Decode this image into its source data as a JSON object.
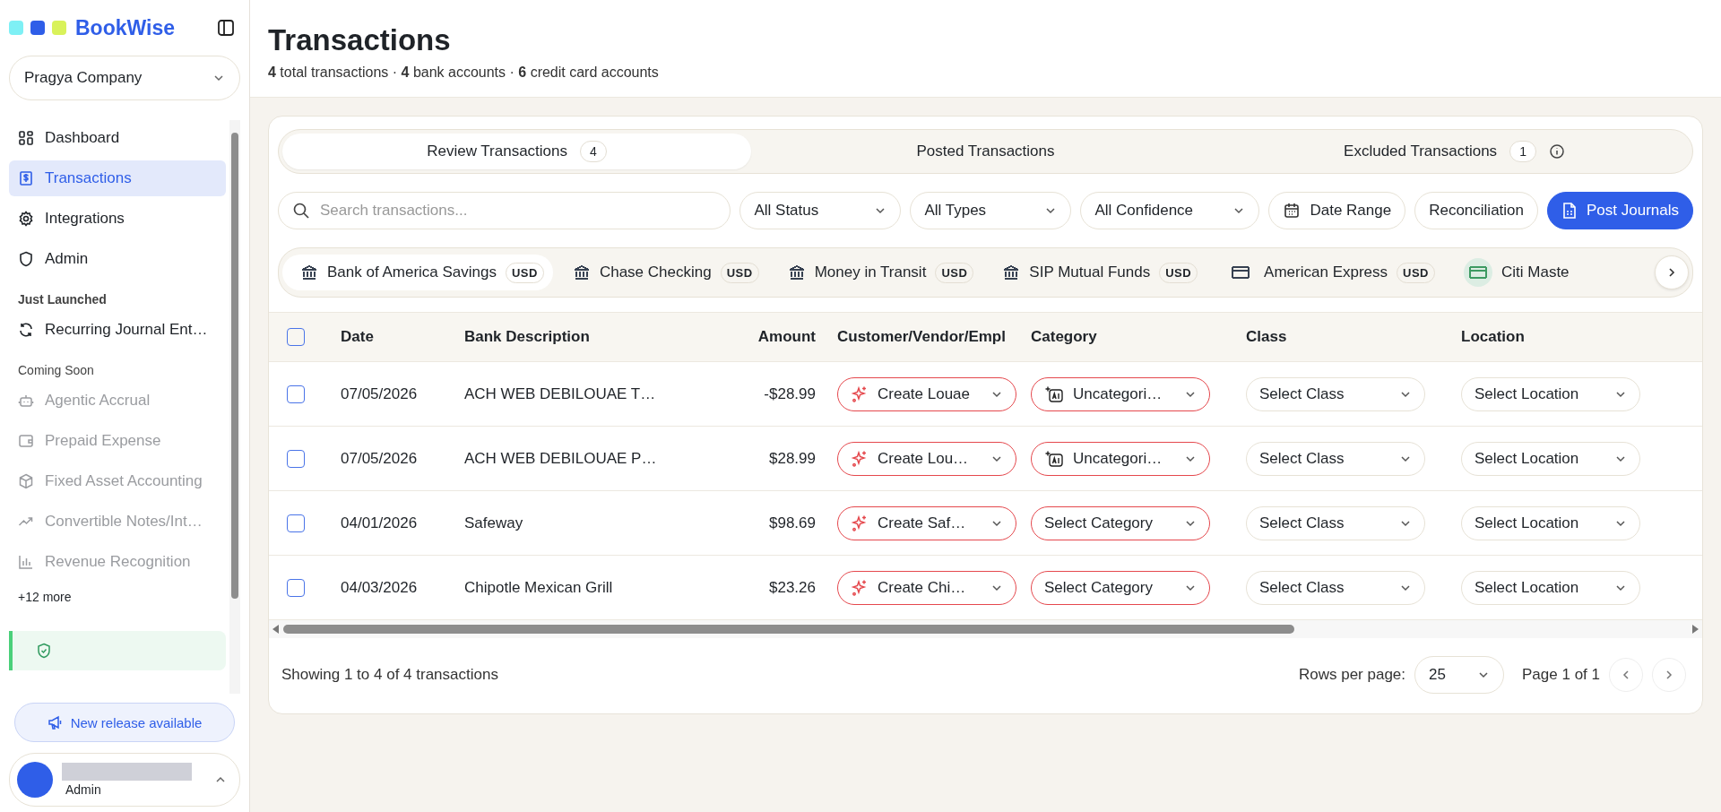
{
  "sidebar": {
    "brand": "BookWise",
    "company": "Pragya Company",
    "nav": [
      {
        "label": "Dashboard",
        "selected": false
      },
      {
        "label": "Transactions",
        "selected": true
      },
      {
        "label": "Integrations",
        "selected": false
      },
      {
        "label": "Admin",
        "selected": false
      }
    ],
    "sections": [
      {
        "title": "Just Launched",
        "items": [
          {
            "label": "Recurring Journal Ent…",
            "disabled": false
          }
        ]
      },
      {
        "title": "Coming Soon",
        "items": [
          {
            "label": "Agentic Accrual",
            "disabled": true
          },
          {
            "label": "Prepaid Expense",
            "disabled": true
          },
          {
            "label": "Fixed Asset Accounting",
            "disabled": true
          },
          {
            "label": "Convertible Notes/Int…",
            "disabled": true
          },
          {
            "label": "Revenue Recognition",
            "disabled": true
          }
        ]
      }
    ],
    "more": "+12 more",
    "release_button": "New release available",
    "user": {
      "role": "Admin"
    }
  },
  "header": {
    "title": "Transactions",
    "summary": "**4** total transactions · **4** bank accounts · **6** credit card accounts"
  },
  "tabs": [
    {
      "label": "Review Transactions",
      "count": "4",
      "selected": true,
      "info": false
    },
    {
      "label": "Posted Transactions",
      "selected": false,
      "info": false
    },
    {
      "label": "Excluded Transactions",
      "count": "1",
      "selected": false,
      "info": true
    }
  ],
  "filters": {
    "search_placeholder": "Search transactions...",
    "selects": [
      "All Status",
      "All Types",
      "All Confidence"
    ],
    "date_range": "Date Range",
    "reconciliation": "Reconciliation",
    "post_button": "Post Journals"
  },
  "accounts": [
    {
      "name": "Bank of America Savings",
      "currency": "USD",
      "kind": "bank",
      "selected": true,
      "color": "#374151"
    },
    {
      "name": "Chase Checking",
      "currency": "USD",
      "kind": "bank",
      "selected": false,
      "color": "#374151"
    },
    {
      "name": "Money in Transit",
      "currency": "USD",
      "kind": "bank",
      "selected": false,
      "color": "#374151"
    },
    {
      "name": "SIP Mutual Funds",
      "currency": "USD",
      "kind": "bank",
      "selected": false,
      "color": "#374151"
    },
    {
      "name": "American Express",
      "currency": "USD",
      "kind": "card",
      "selected": false,
      "color": "#374151"
    },
    {
      "name": "Citi Maste",
      "kind": "card",
      "selected": false,
      "color": "#3d9a62"
    }
  ],
  "table": {
    "columns": [
      "Date",
      "Bank Description",
      "Amount",
      "Customer/Vendor/Empl",
      "Category",
      "Class",
      "Location"
    ],
    "all_checked": false,
    "rows": [
      {
        "checked": false,
        "date": "07/05/2026",
        "description": "ACH WEB DEBILOUAE T…",
        "amount": "-$28.99",
        "vendor": {
          "text": "Create Louae",
          "kind": "sparkle",
          "invalid": true
        },
        "category": {
          "text": "Uncategori…",
          "kind": "ai",
          "invalid": true
        },
        "class": {
          "text": "Select Class",
          "invalid": false
        },
        "location": {
          "text": "Select Location",
          "invalid": false
        }
      },
      {
        "checked": false,
        "date": "07/05/2026",
        "description": "ACH WEB DEBILOUAE P…",
        "amount": "$28.99",
        "vendor": {
          "text": "Create Lou…",
          "kind": "sparkle",
          "invalid": true
        },
        "category": {
          "text": "Uncategori…",
          "kind": "ai",
          "invalid": true
        },
        "class": {
          "text": "Select Class",
          "invalid": false
        },
        "location": {
          "text": "Select Location",
          "invalid": false
        }
      },
      {
        "checked": false,
        "date": "04/01/2026",
        "description": "Safeway",
        "amount": "$98.69",
        "vendor": {
          "text": "Create Saf…",
          "kind": "sparkle",
          "invalid": true
        },
        "category": {
          "text": "Select Category",
          "kind": "plain",
          "invalid": true
        },
        "class": {
          "text": "Select Class",
          "invalid": false
        },
        "location": {
          "text": "Select Location",
          "invalid": false
        }
      },
      {
        "checked": false,
        "date": "04/03/2026",
        "description": "Chipotle Mexican Grill",
        "amount": "$23.26",
        "vendor": {
          "text": "Create Chi…",
          "kind": "sparkle",
          "invalid": true
        },
        "category": {
          "text": "Select Category",
          "kind": "plain",
          "invalid": true
        },
        "class": {
          "text": "Select Class",
          "invalid": false
        },
        "location": {
          "text": "Select Location",
          "invalid": false
        }
      }
    ]
  },
  "footer": {
    "showing": "Showing 1 to 4 of 4 transactions",
    "rows_label": "Rows per page:",
    "rows_value": "25",
    "page": "Page 1 of 1"
  }
}
